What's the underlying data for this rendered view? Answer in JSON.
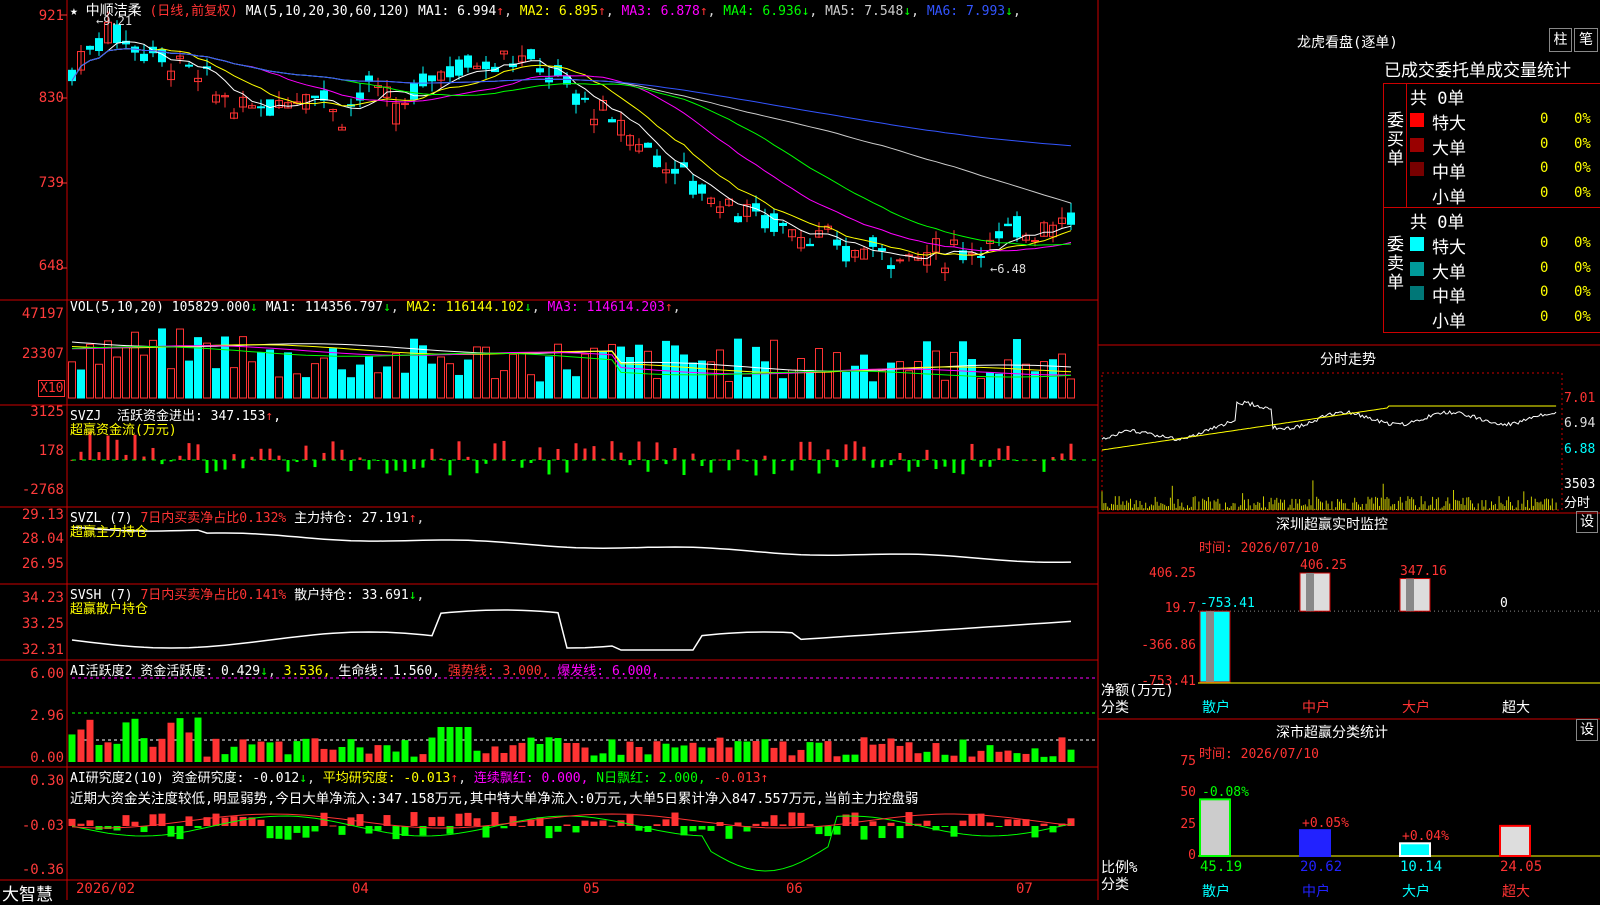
{
  "stock": {
    "star": "★",
    "name": "中顺洁柔",
    "period": "(日线,前复权)",
    "ma_label": "MA(5,10,20,30,60,120)",
    "ma": [
      {
        "label": "MA1:",
        "value": "6.994",
        "arrow": "↑",
        "color": "#ffffff"
      },
      {
        "label": "MA2:",
        "value": "6.895",
        "arrow": "↑",
        "color": "#ffff00"
      },
      {
        "label": "MA3:",
        "value": "6.878",
        "arrow": "↑",
        "color": "#ff00ff"
      },
      {
        "label": "MA4:",
        "value": "6.936",
        "arrow": "↓",
        "color": "#00ff00"
      },
      {
        "label": "MA5:",
        "value": "7.548",
        "arrow": "↓",
        "color": "#cccccc"
      },
      {
        "label": "MA6:",
        "value": "7.993",
        "arrow": "↓",
        "color": "#3355ff"
      }
    ],
    "high_mark": "9.21",
    "low_mark": "6.48",
    "price_ticks": [
      "921",
      "830",
      "739",
      "648"
    ]
  },
  "vol": {
    "label": "VOL(5,10,20)",
    "value": "105829.000",
    "value_arrow": "↓",
    "ma": [
      {
        "label": "MA1:",
        "value": "114356.797",
        "arrow": "↓",
        "color": "#ffffff"
      },
      {
        "label": "MA2:",
        "value": "116144.102",
        "arrow": "↓",
        "color": "#ffff00"
      },
      {
        "label": "MA3:",
        "value": "114614.203",
        "arrow": "↑",
        "color": "#ff00ff"
      }
    ],
    "ticks": [
      "47197",
      "23307"
    ],
    "unit": "X10"
  },
  "svzj": {
    "label": "SVZJ",
    "text": "活跃资金进出: 347.153",
    "arrow": "↑",
    "sub": "超赢资金流(万元)",
    "ticks": [
      "3125",
      "178",
      "-2768"
    ]
  },
  "svzl": {
    "label": "SVZL (7)",
    "text_red": "7日内买卖净占比0.132%",
    "text_white": "主力持仓: 27.191",
    "arrow": "↑",
    "sub": "超赢主力持仓",
    "ticks": [
      "29.13",
      "28.04",
      "26.95"
    ]
  },
  "svsh": {
    "label": "SVSH (7)",
    "text_red": "7日内买卖净占比0.141%",
    "text_white": "散户持仓: 33.691",
    "arrow": "↓",
    "sub": "超赢散户持仓",
    "ticks": [
      "34.23",
      "33.25",
      "32.31"
    ]
  },
  "ai1": {
    "label": "AI活跃度2",
    "text": "资金活跃度: 0.429",
    "arrow": "↓",
    "v2": "3.536,",
    "life": "生命线: 1.560,",
    "strong": "强势线: 3.000,",
    "burst": "爆发线: 6.000,",
    "ticks": [
      "6.00",
      "2.96",
      "0.00"
    ]
  },
  "ai2": {
    "label": "AI研究度2(10)",
    "text": "资金研究度: -0.012",
    "arrow1": "↓",
    "avg": "平均研究度: -0.013",
    "arrow2": "↑",
    "red1": "连续飘红: 0.000,",
    "red2": "N日飘红: 2.000,",
    "last": "-0.013",
    "arrow3": "↑",
    "comment": "近期大资金关注度较低,明显弱势,今日大单净流入:347.158万元,其中特大单净流入:0万元,大单5日累计净入847.557万元,当前主力控盘弱",
    "ticks": [
      "0.30",
      "-0.03",
      "-0.36"
    ]
  },
  "xaxis": {
    "brand": "大智慧",
    "labels": [
      "2026/02",
      "04",
      "05",
      "06",
      "07"
    ]
  },
  "dragon": {
    "title": "龙虎看盘(逐单)",
    "btn_bar": "柱",
    "btn_pen": "笔",
    "header": "已成交委托单成交量统计",
    "buy": {
      "side": "委买单",
      "total": "共 0单",
      "rows": [
        {
          "name": "特大",
          "n": "0",
          "pct": "0%",
          "color": "#ff0000"
        },
        {
          "name": "大单",
          "n": "0",
          "pct": "0%",
          "color": "#990000"
        },
        {
          "name": "中单",
          "n": "0",
          "pct": "0%",
          "color": "#770000"
        },
        {
          "name": "小单",
          "n": "0",
          "pct": "0%",
          "color": "#000000"
        }
      ]
    },
    "sell": {
      "side": "委卖单",
      "total": "共 0单",
      "rows": [
        {
          "name": "特大",
          "n": "0",
          "pct": "0%",
          "color": "#00ffff"
        },
        {
          "name": "大单",
          "n": "0",
          "pct": "0%",
          "color": "#009999"
        },
        {
          "name": "中单",
          "n": "0",
          "pct": "0%",
          "color": "#007777"
        },
        {
          "name": "小单",
          "n": "0",
          "pct": "0%",
          "color": "#000000"
        }
      ]
    }
  },
  "intraday": {
    "title": "分时走势",
    "ticks": [
      "7.01",
      "6.94",
      "6.88"
    ],
    "vol_tick": "3503",
    "vol_label": "分时"
  },
  "sz_monitor": {
    "title": "深圳超赢实时监控",
    "btn": "设",
    "time": "时间: 2026/07/10",
    "ticks": [
      "406.25",
      "19.7",
      "-366.86",
      "-753.41"
    ],
    "ylabel": "净额(万元)",
    "xlabel": "分类",
    "categories": [
      "散户",
      "中户",
      "大户",
      "超大"
    ],
    "values": [
      "-753.41",
      "406.25",
      "347.16",
      "0"
    ]
  },
  "sz_stats": {
    "title": "深市超赢分类统计",
    "btn": "设",
    "time": "时间: 2026/07/10",
    "ticks": [
      "75",
      "50",
      "25",
      "0"
    ],
    "ylabel": "比例%",
    "xlabel": "分类",
    "categories": [
      "散户",
      "中户",
      "大户",
      "超大"
    ],
    "values": [
      "45.19",
      "20.62",
      "10.14",
      "24.05"
    ],
    "changes": [
      "-0.08%",
      "+0.05%",
      "+0.04%",
      ""
    ]
  },
  "colors": {
    "up": "#ff3333",
    "down": "#00ffff",
    "border": "#cc0000",
    "green": "#00ff00"
  }
}
